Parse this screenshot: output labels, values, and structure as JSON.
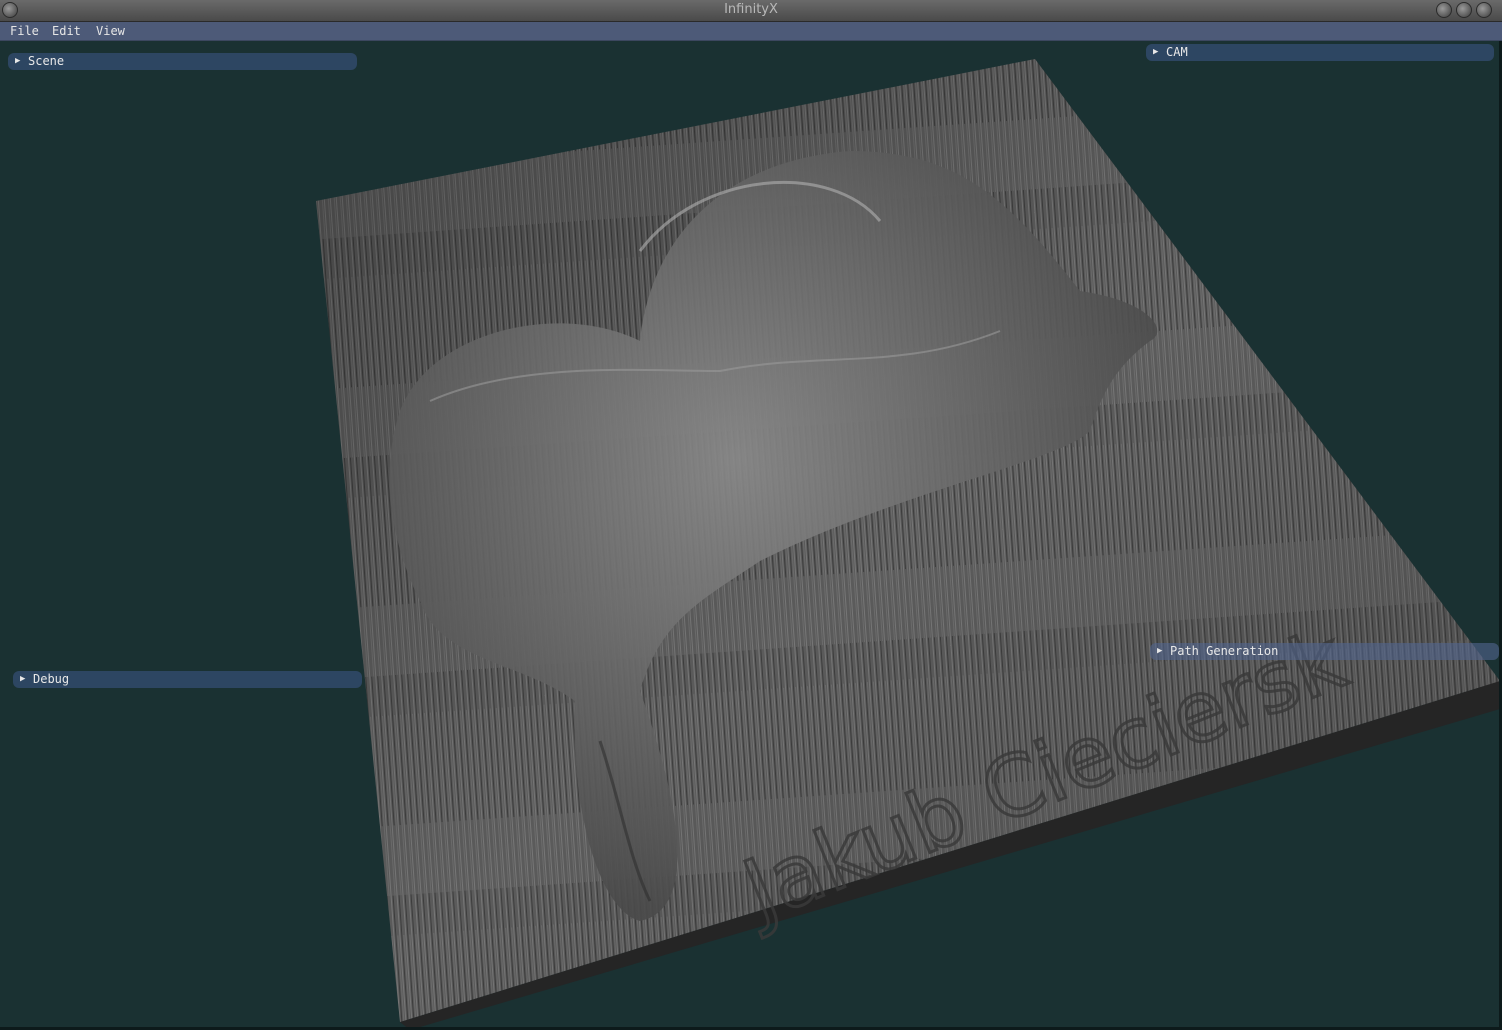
{
  "window": {
    "title": "InfinityX"
  },
  "menubar": {
    "items": [
      {
        "label": "File"
      },
      {
        "label": "Edit"
      },
      {
        "label": "View"
      }
    ]
  },
  "panels": {
    "scene": {
      "label": "Scene",
      "expanded": false
    },
    "cam": {
      "label": "CAM",
      "expanded": false
    },
    "debug": {
      "label": "Debug",
      "expanded": false
    },
    "path_generation": {
      "label": "Path Generation",
      "expanded": false
    }
  },
  "viewport": {
    "engraved_text": "Jakub Cieciersk",
    "colors": {
      "background": "#1a3132",
      "panel": "#2d4662",
      "menubar": "#4d5a78",
      "stock": "#5a5a5a"
    }
  }
}
